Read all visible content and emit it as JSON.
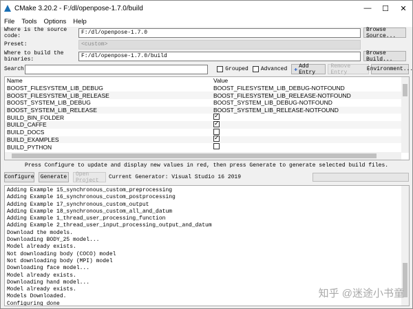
{
  "window": {
    "title": "CMake 3.20.2 - F:/dl/openpose-1.7.0/build",
    "min": "—",
    "max": "☐",
    "close": "✕"
  },
  "menu": [
    "File",
    "Tools",
    "Options",
    "Help"
  ],
  "source": {
    "label": "Where is the source code:",
    "value": "F:/dl/openpose-1.7.0",
    "button": "Browse Source..."
  },
  "preset": {
    "label": "Preset:",
    "value": "<custom>"
  },
  "build": {
    "label": "Where to build the binaries:",
    "value": "F:/dl/openpose-1.7.0/build",
    "button": "Browse Build..."
  },
  "search": {
    "label": "Search:",
    "value": "",
    "grouped": "Grouped",
    "advanced": "Advanced",
    "add": "Add Entry",
    "remove": "Remove Entry",
    "env": "Environment..."
  },
  "table": {
    "headers": [
      "Name",
      "Value"
    ],
    "rows": [
      {
        "name": "BOOST_FILESYSTEM_LIB_DEBUG",
        "value": "BOOST_FILESYSTEM_LIB_DEBUG-NOTFOUND"
      },
      {
        "name": "BOOST_FILESYSTEM_LIB_RELEASE",
        "value": "BOOST_FILESYSTEM_LIB_RELEASE-NOTFOUND"
      },
      {
        "name": "BOOST_SYSTEM_LIB_DEBUG",
        "value": "BOOST_SYSTEM_LIB_DEBUG-NOTFOUND"
      },
      {
        "name": "BOOST_SYSTEM_LIB_RELEASE",
        "value": "BOOST_SYSTEM_LIB_RELEASE-NOTFOUND"
      },
      {
        "name": "BUILD_BIN_FOLDER",
        "checked": true
      },
      {
        "name": "BUILD_CAFFE",
        "checked": true
      },
      {
        "name": "BUILD_DOCS",
        "checked": false
      },
      {
        "name": "BUILD_EXAMPLES",
        "checked": true
      },
      {
        "name": "BUILD_PYTHON",
        "checked": false
      }
    ]
  },
  "hint": "Press Configure to update and display new values in red, then press Generate to generate selected build files.",
  "actions": {
    "configure": "Configure",
    "generate": "Generate",
    "open": "Open Project",
    "generator": "Current Generator: Visual Studio 16 2019"
  },
  "log": [
    "Adding Example 15_synchronous_custom_preprocessing",
    "Adding Example 16_synchronous_custom_postprocessing",
    "Adding Example 17_synchronous_custom_output",
    "Adding Example 18_synchronous_custom_all_and_datum",
    "Adding Example 1_thread_user_processing_function",
    "Adding Example 2_thread_user_input_processing_output_and_datum",
    "Download the models.",
    "Downloading BODY_25 model...",
    "Model already exists.",
    "Not downloading body (COCO) model",
    "Not downloading body (MPI) model",
    "Downloading face model...",
    "Model already exists.",
    "Downloading hand model...",
    "Model already exists.",
    "Models Downloaded.",
    "Configuring done"
  ],
  "watermark": "知乎 @迷途小书童"
}
